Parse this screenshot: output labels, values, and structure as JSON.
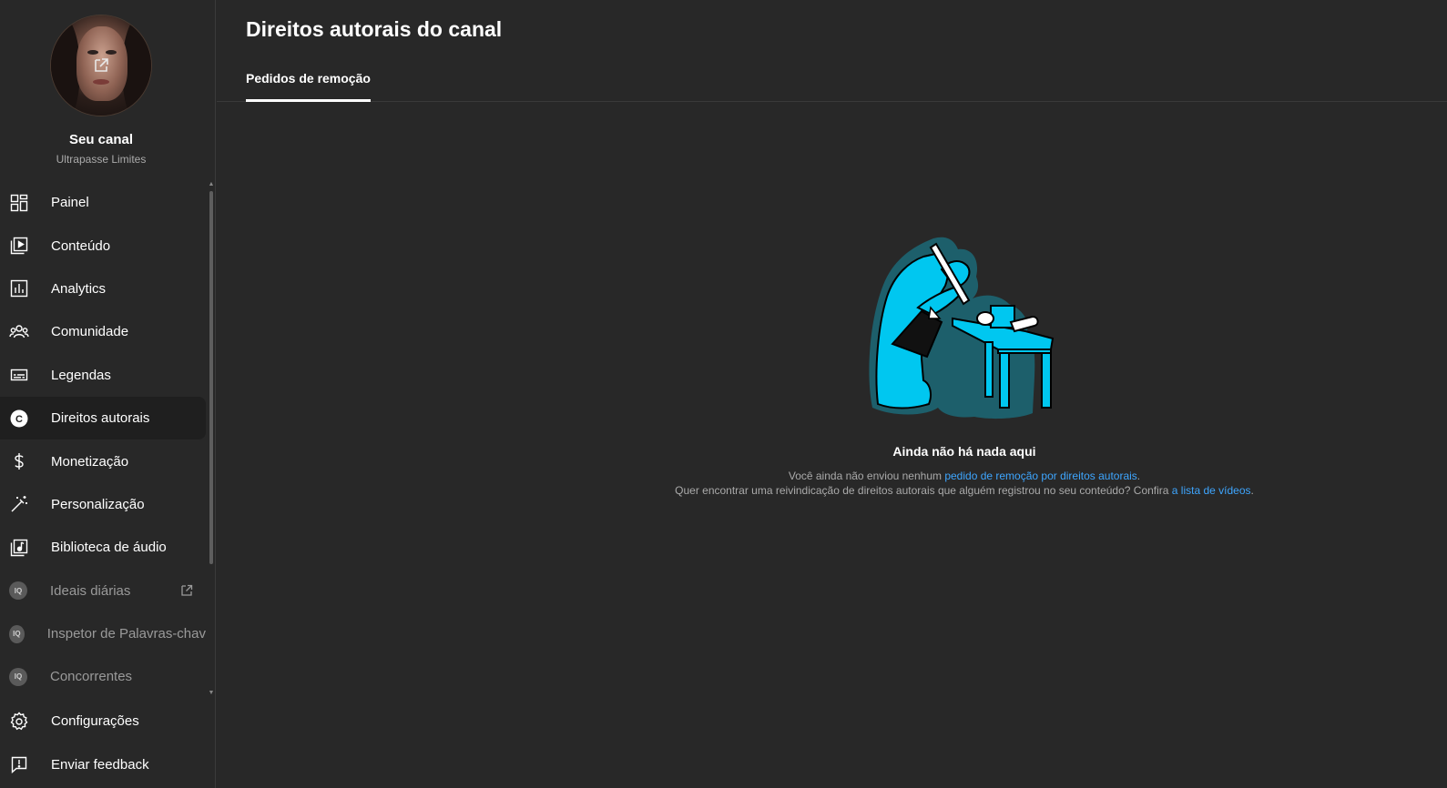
{
  "profile": {
    "channel_title": "Seu canal",
    "channel_name": "Ultrapasse Limites",
    "avatar_icon": "external-link-icon"
  },
  "nav": {
    "items": [
      {
        "label": "Painel",
        "icon": "dashboard-icon"
      },
      {
        "label": "Conteúdo",
        "icon": "content-icon"
      },
      {
        "label": "Analytics",
        "icon": "analytics-icon"
      },
      {
        "label": "Comunidade",
        "icon": "community-icon"
      },
      {
        "label": "Legendas",
        "icon": "subtitles-icon"
      },
      {
        "label": "Direitos autorais",
        "icon": "copyright-icon",
        "active": true
      },
      {
        "label": "Monetização",
        "icon": "dollar-icon"
      },
      {
        "label": "Personalização",
        "icon": "magic-wand-icon"
      },
      {
        "label": "Biblioteca de áudio",
        "icon": "audio-library-icon"
      },
      {
        "label": "Ideais diárias",
        "icon": "extension-icon",
        "external": true
      },
      {
        "label": "Inspetor de Palavras-chav",
        "icon": "extension-icon"
      },
      {
        "label": "Concorrentes",
        "icon": "extension-icon"
      }
    ],
    "extension_badge": "IQ"
  },
  "bottom_nav": {
    "settings": "Configurações",
    "feedback": "Enviar feedback"
  },
  "main": {
    "title": "Direitos autorais do canal",
    "tabs": [
      {
        "label": "Pedidos de remoção",
        "active": true
      }
    ],
    "empty_state": {
      "title": "Ainda não há nada aqui",
      "line1_prefix": "Você ainda não enviou nenhum ",
      "line1_link": "pedido de remoção por direitos autorais",
      "line1_suffix": ".",
      "line2_prefix": "Quer encontrar uma reivindicação de direitos autorais que alguém registrou no seu conteúdo? Confira ",
      "line2_link": "a lista de vídeos",
      "line2_suffix": "."
    }
  },
  "colors": {
    "background": "#282828",
    "active_nav": "#1f1f1f",
    "link": "#3ea6ff",
    "illustration_cyan": "#00c7f0",
    "illustration_teal": "#1d5f6b"
  }
}
